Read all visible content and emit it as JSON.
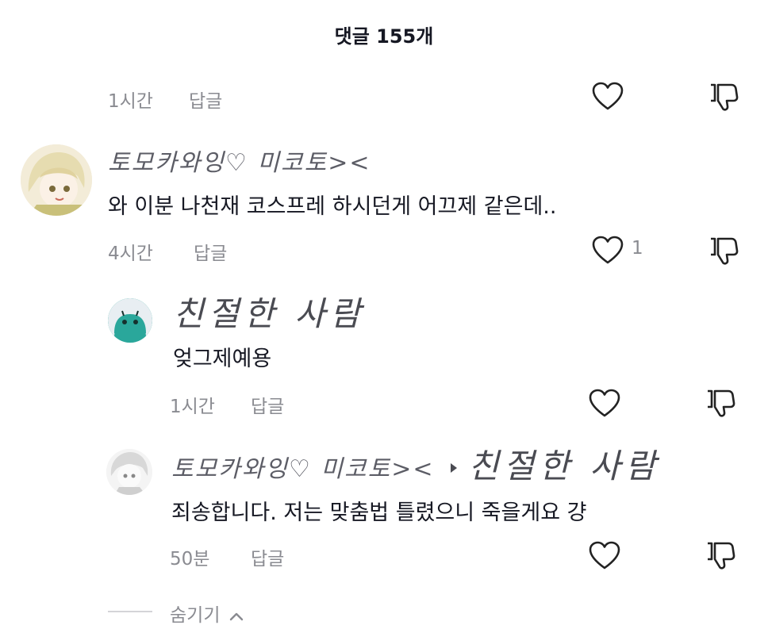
{
  "header": {
    "title": "댓글 155개"
  },
  "top_row": {
    "time": "1시간",
    "reply_label": "답글"
  },
  "comment": {
    "username": "토모카와잉♡ 미코토><",
    "text": "와 이분 나천재 코스프레 하시던게 어끄제 같은데..",
    "time": "4시간",
    "reply_label": "답글",
    "like_count": "1"
  },
  "replies": [
    {
      "username": "친절한 사람",
      "text": "엊그제예용",
      "time": "1시간",
      "reply_label": "답글"
    },
    {
      "username": "토모카와잉♡ 미코토><",
      "reply_to": "친절한 사람",
      "text": "죄송합니다. 저는 맞춤법 틀렸으니 죽을게요 걍",
      "time": "50분",
      "reply_label": "답글"
    }
  ],
  "hide_label": "숨기기",
  "colors": {
    "muted": "#8a8b91",
    "text": "#161823",
    "teal_avatar": "#2aa79b"
  }
}
